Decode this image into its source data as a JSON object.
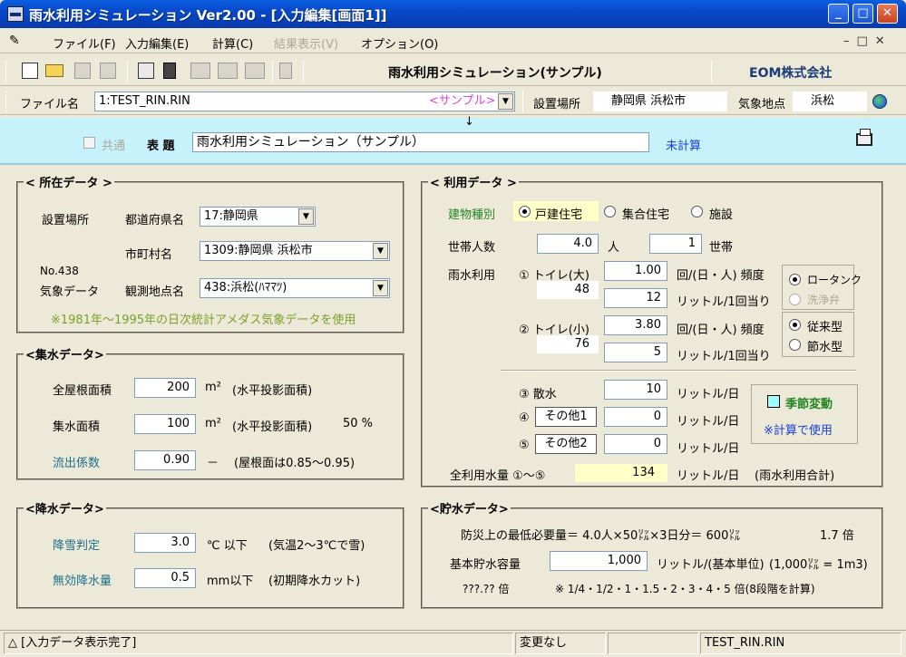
{
  "window": {
    "title": "雨水利用シミュレーション Ver2.00 - [入力編集[画面1]]"
  },
  "menu": {
    "items": [
      {
        "label": "ファイル(F)",
        "enabled": true
      },
      {
        "label": "入力編集(E)",
        "enabled": true
      },
      {
        "label": "計算(C)",
        "enabled": true
      },
      {
        "label": "結果表示(V)",
        "enabled": false
      },
      {
        "label": "オプション(O)",
        "enabled": true
      }
    ]
  },
  "toolbar": {
    "title": "雨水利用シミュレーション(サンプル)",
    "company": "EOM株式会社"
  },
  "file_row": {
    "file_label": "ファイル名",
    "file_value": "1:TEST_RIN.RIN",
    "sample_tag": "<サンプル>",
    "location_label": "設置場所",
    "location_value": "静岡県 浜松市",
    "weather_label": "気象地点",
    "weather_value": "浜松",
    "arrow": "↓"
  },
  "header": {
    "common_label": "共通",
    "title_label": "表 題",
    "title_value": "雨水利用シミュレーション（サンプル）",
    "calc_status": "未計算"
  },
  "location": {
    "group_title": "< 所在データ >",
    "place_label": "設置場所",
    "pref_label": "都道府県名",
    "pref_value": "17:静岡県",
    "city_label": "市町村名",
    "city_value": "1309:静岡県 浜松市",
    "station_no": "No.438",
    "weather_label": "気象データ",
    "station_label": "観測地点名",
    "station_value": "438:浜松(ﾊﾏﾏﾂ)",
    "note": "※1981年～1995年の日次統計アメダス気象データを使用"
  },
  "catchment": {
    "group_title": "<集水データ>",
    "roof_label": "全屋根面積",
    "roof_value": "200",
    "roof_unit": "m²",
    "roof_note": "(水平投影面積)",
    "catch_label": "集水面積",
    "catch_value": "100",
    "catch_unit": "m²",
    "catch_note": "(水平投影面積)",
    "catch_pct": "50 %",
    "runoff_label": "流出係数",
    "runoff_value": "0.90",
    "runoff_unit": "－",
    "runoff_note": "(屋根面は0.85～0.95)"
  },
  "precip": {
    "group_title": "<降水データ>",
    "snow_label": "降雪判定",
    "snow_value": "3.0",
    "snow_unit": "℃ 以下",
    "snow_note": "(気温2～3℃で雪)",
    "invalid_label": "無効降水量",
    "invalid_value": "0.5",
    "invalid_unit": "mm以下",
    "invalid_note": "(初期降水カット)"
  },
  "usage": {
    "group_title": "< 利用データ >",
    "building_label": "建物種別",
    "building_options": [
      "戸建住宅",
      "集合住宅",
      "施設"
    ],
    "building_selected": 0,
    "household_label": "世帯人数",
    "persons_value": "4.0",
    "persons_unit": "人",
    "households_value": "1",
    "households_unit": "世帯",
    "rain_use_label": "雨水利用",
    "toilet_big_label": "① トイレ(大)",
    "toilet_big_freq": "1.00",
    "toilet_big_sub": "48",
    "toilet_big_amount": "12",
    "toilet_small_label": "② トイレ(小)",
    "toilet_small_freq": "3.80",
    "toilet_small_sub": "76",
    "toilet_small_amount": "5",
    "freq_unit": "回/(日・人) 頻度",
    "amount_unit": "リットル/1回当り",
    "tank_options": [
      "ロータンク",
      "洗浄弁"
    ],
    "flush_options": [
      "従来型",
      "節水型"
    ],
    "sprinkle_label": "③ 散水",
    "sprinkle_value": "10",
    "other1_num": "④",
    "other1_label": "その他1",
    "other1_value": "0",
    "other2_num": "⑤",
    "other2_label": "その他2",
    "other2_value": "0",
    "per_day_unit": "リットル/日",
    "seasonal_label": "季節変動",
    "seasonal_note": "※計算で使用",
    "total_label": "全利用水量 ①～⑤",
    "total_value": "134",
    "total_unit": "リットル/日",
    "total_note": "(雨水利用合計)"
  },
  "storage": {
    "group_title": "<貯水データ>",
    "disaster_line": "防災上の最低必要量＝ 4.0人×50㍑×3日分＝ 600㍑",
    "ratio": "1.7 倍",
    "basic_label": "基本貯水容量",
    "basic_value": "1,000",
    "basic_unit": "リットル/(基本単位)",
    "basic_note": "(1,000㍑ = 1m3)",
    "multiplier": "???.?? 倍",
    "steps_note": "※ 1/4・1/2・1・1.5・2・3・4・5 倍(8段階を計算)"
  },
  "status": {
    "message": "△ [入力データ表示完了]",
    "change": "変更なし",
    "file": "TEST_RIN.RIN"
  }
}
